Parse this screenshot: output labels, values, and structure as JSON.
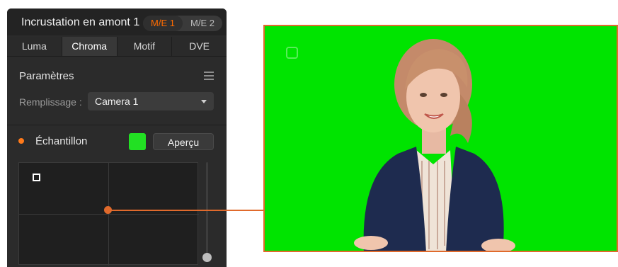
{
  "panel": {
    "title": "Incrustation en amont 1",
    "me_buttons": [
      "M/E 1",
      "M/E 2"
    ],
    "tabs": [
      "Luma",
      "Chroma",
      "Motif",
      "DVE"
    ],
    "section_title": "Paramètres",
    "fill_label": "Remplissage :",
    "fill_value": "Camera 1",
    "sample_label": "Échantillon",
    "preview_button": "Aperçu"
  },
  "colors": {
    "accent": "#ff6b00",
    "callout": "#e06a2c",
    "key_green": "#00e400",
    "swatch_green": "#22e023"
  },
  "icons": {
    "menu": "menu-icon",
    "dropdown": "chevron-down-icon",
    "status": "sample-status-dot"
  }
}
